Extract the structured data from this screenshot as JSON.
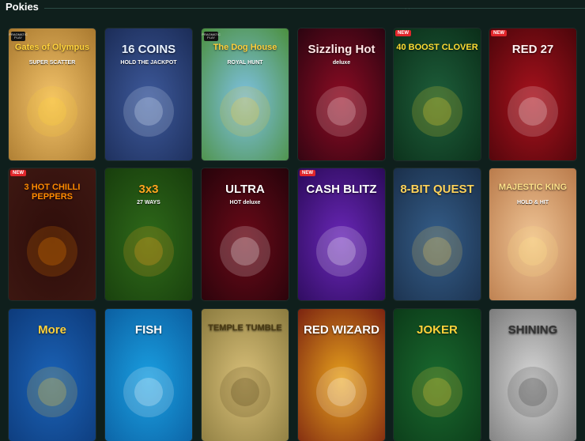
{
  "section": {
    "title": "Pokies",
    "dots": "∙∙"
  },
  "tiles": [
    {
      "title": "Gates of Olympus",
      "sub": "SUPER SCATTER",
      "badge": "",
      "provider": "PRAGMATIC PLAY",
      "bg1": "#f3c36a",
      "bg2": "#a8782e",
      "titleColor": "#ffd23b"
    },
    {
      "title": "16 COINS",
      "sub": "HOLD THE JACKPOT",
      "badge": "",
      "provider": "",
      "bg1": "#3e5a9c",
      "bg2": "#1b2c57",
      "titleColor": "#e9f2ff"
    },
    {
      "title": "The Dog House",
      "sub": "ROYAL HUNT",
      "badge": "",
      "provider": "PRAGMATIC PLAY",
      "bg1": "#7fc2e5",
      "bg2": "#4b8f3d",
      "titleColor": "#ffcf3a"
    },
    {
      "title": "Sizzling Hot",
      "sub": "deluxe",
      "badge": "",
      "provider": "",
      "bg1": "#8e0c24",
      "bg2": "#2a0410",
      "titleColor": "#ffe6e6"
    },
    {
      "title": "40 BOOST CLOVER",
      "sub": "",
      "badge": "NEW",
      "provider": "",
      "bg1": "#1e5f3b",
      "bg2": "#0a2d18",
      "titleColor": "#ffdd34"
    },
    {
      "title": "RED 27",
      "sub": "",
      "badge": "NEW",
      "provider": "",
      "bg1": "#a9121d",
      "bg2": "#4b050a",
      "titleColor": "#fff2f2"
    },
    {
      "title": "3 HOT CHILLI PEPPERS",
      "sub": "",
      "badge": "NEW",
      "provider": "",
      "bg1": "#2e0d0a",
      "bg2": "#3e1812",
      "titleColor": "#ff8a00"
    },
    {
      "title": "3x3",
      "sub": "27 WAYS",
      "badge": "",
      "provider": "",
      "bg1": "#2f6a1a",
      "bg2": "#173d0c",
      "titleColor": "#ffa51f"
    },
    {
      "title": "ULTRA",
      "sub": "HOT deluxe",
      "badge": "",
      "provider": "",
      "bg1": "#6b0a18",
      "bg2": "#25030a",
      "titleColor": "#ffffff"
    },
    {
      "title": "CASH BLITZ",
      "sub": "",
      "badge": "NEW",
      "provider": "",
      "bg1": "#6a27b8",
      "bg2": "#2a0a58",
      "titleColor": "#ffffff"
    },
    {
      "title": "8-BIT QUEST",
      "sub": "",
      "badge": "",
      "provider": "",
      "bg1": "#355e8a",
      "bg2": "#1a2f4a",
      "titleColor": "#ffd35a"
    },
    {
      "title": "MAJESTIC KING",
      "sub": "HOLD & HIT",
      "badge": "",
      "provider": "",
      "bg1": "#f0c596",
      "bg2": "#b97a4a",
      "titleColor": "#ffe28a"
    },
    {
      "title": "More",
      "sub": "",
      "badge": "",
      "provider": "",
      "bg1": "#1b63b7",
      "bg2": "#0d3a7a",
      "titleColor": "#ffd23b"
    },
    {
      "title": "FISH",
      "sub": "",
      "badge": "",
      "provider": "",
      "bg1": "#1aa0e2",
      "bg2": "#0b5ea0",
      "titleColor": "#ffffff"
    },
    {
      "title": "TEMPLE TUMBLE",
      "sub": "",
      "badge": "",
      "provider": "",
      "bg1": "#d9c079",
      "bg2": "#8a7a3e",
      "titleColor": "#4a3a12"
    },
    {
      "title": "RED WIZARD",
      "sub": "",
      "badge": "",
      "provider": "",
      "bg1": "#e8a21d",
      "bg2": "#7a2210",
      "titleColor": "#ffffff"
    },
    {
      "title": "JOKER",
      "sub": "",
      "badge": "",
      "provider": "",
      "bg1": "#1a6a2f",
      "bg2": "#0b3a18",
      "titleColor": "#ffd23b"
    },
    {
      "title": "SHINING",
      "sub": "",
      "badge": "",
      "provider": "",
      "bg1": "#d8d8d8",
      "bg2": "#7a7a7a",
      "titleColor": "#333333"
    }
  ]
}
